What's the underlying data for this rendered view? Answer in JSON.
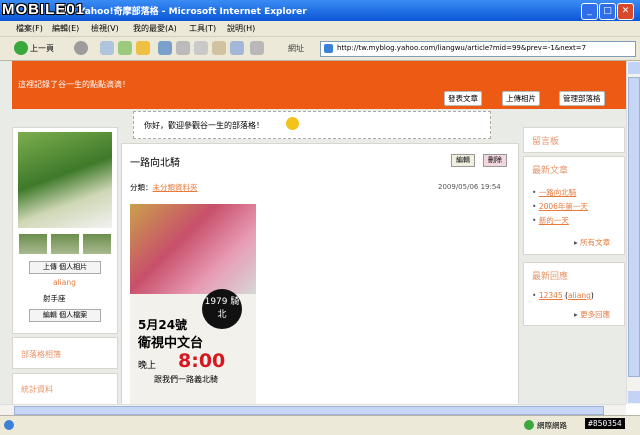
{
  "window": {
    "title": "格 - Yahoo!奇摩部落格 - Microsoft Internet Explorer",
    "watermark": "MOBILE01",
    "min": "_",
    "max": "□",
    "close": "✕"
  },
  "menu": [
    "檔案(F)",
    "編輯(E)",
    "檢視(V)",
    "我的最愛(A)",
    "工具(T)",
    "說明(H)"
  ],
  "toolbar": {
    "back": "上一頁",
    "address_label": "網址",
    "address_value": "http://tw.myblog.yahoo.com/liangwu/article?mid=99&prev=-1&next=7"
  },
  "blog": {
    "description": "這裡記錄了谷一生的點點滴滴！",
    "buttons": [
      "發表文章",
      "上傳相片",
      "管理部落格"
    ],
    "welcome": "你好，歡迎參觀谷一生的部落格！"
  },
  "left": {
    "upload_photo": "上傳 個人相片",
    "username": "aliang",
    "zodiac": "射手座",
    "edit_profile": "編輯 個人檔案",
    "links_title": "部落格相簿",
    "stats_title": "統計資料"
  },
  "post": {
    "title": "一路向北騎",
    "edit": "編輯",
    "delete": "刪除",
    "category_label": "分類：",
    "category_value": "未分類資料夾",
    "date": "2009/05/06 19:54",
    "poster": {
      "badge": "1979 騎北",
      "date": "5月24號",
      "channel": "衛視中文台",
      "time_prefix": "晚上",
      "time": "8:00",
      "slogan": "跟我們一路義北騎"
    }
  },
  "right": {
    "guestbook": "留言板",
    "latest_title": "最新文章",
    "latest": [
      "一路向北騎",
      "2006年第一天",
      "新的一天"
    ],
    "latest_more": "所有文章",
    "replies_title": "最新回應",
    "reply_id": "12345",
    "reply_user": "aliang",
    "replies_more": "更多回應"
  },
  "status": {
    "zone": "網際網路",
    "tag": "#850354"
  },
  "colors": {
    "header": "#ec5a14",
    "accent": "#e87a3c"
  }
}
